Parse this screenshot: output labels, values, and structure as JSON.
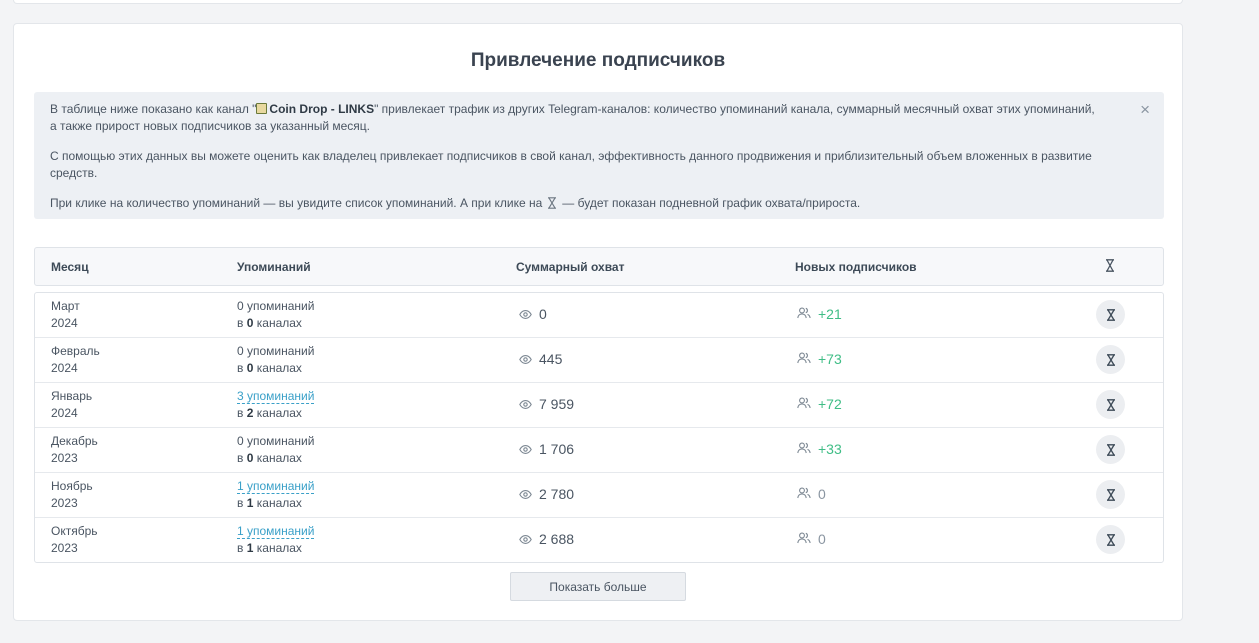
{
  "title": "Привлечение подписчиков",
  "info": {
    "p1_before": "В таблице ниже показано как канал \"",
    "channel_name": "Coin Drop - LINKS",
    "p1_after": "\" привлекает трафик из других Telegram-каналов: количество упоминаний канала, суммарный месячный охват этих упоминаний, а также прирост новых подписчиков за указанный месяц.",
    "p2": "С помощью этих данных вы можете оценить как владелец привлекает подписчиков в свой канал, эффективность данного продвижения и приблизительный объем вложенных в развитие средств.",
    "p3_before": "При клике на количество упоминаний — вы увидите список упоминаний. А при клике на",
    "p3_after": "— будет показан подневной график охвата/прироста.",
    "close": "×"
  },
  "table": {
    "headers": {
      "month": "Месяц",
      "mentions": "Упоминаний",
      "reach": "Суммарный охват",
      "subs": "Новых подписчиков"
    },
    "rows": [
      {
        "month": "Март",
        "year": "2024",
        "mentions": "0 упоминаний",
        "mentions_link": false,
        "ch_prefix": "в",
        "channels": "0",
        "ch_suffix": "каналах",
        "reach": "0",
        "subs": "+21",
        "subs_positive": true
      },
      {
        "month": "Февраль",
        "year": "2024",
        "mentions": "0 упоминаний",
        "mentions_link": false,
        "ch_prefix": "в",
        "channels": "0",
        "ch_suffix": "каналах",
        "reach": "445",
        "subs": "+73",
        "subs_positive": true
      },
      {
        "month": "Январь",
        "year": "2024",
        "mentions": "3 упоминаний",
        "mentions_link": true,
        "ch_prefix": "в",
        "channels": "2",
        "ch_suffix": "каналах",
        "reach": "7 959",
        "subs": "+72",
        "subs_positive": true
      },
      {
        "month": "Декабрь",
        "year": "2023",
        "mentions": "0 упоминаний",
        "mentions_link": false,
        "ch_prefix": "в",
        "channels": "0",
        "ch_suffix": "каналах",
        "reach": "1 706",
        "subs": "+33",
        "subs_positive": true
      },
      {
        "month": "Ноябрь",
        "year": "2023",
        "mentions": "1 упоминаний",
        "mentions_link": true,
        "ch_prefix": "в",
        "channels": "1",
        "ch_suffix": "каналах",
        "reach": "2 780",
        "subs": "0",
        "subs_positive": false
      },
      {
        "month": "Октябрь",
        "year": "2023",
        "mentions": "1 упоминаний",
        "mentions_link": true,
        "ch_prefix": "в",
        "channels": "1",
        "ch_suffix": "каналах",
        "reach": "2 688",
        "subs": "0",
        "subs_positive": false
      }
    ]
  },
  "more_label": "Показать больше",
  "icons": {
    "hourglass": "hourglass-icon",
    "eye": "eye-icon",
    "users": "users-icon",
    "close": "close-icon",
    "channel": "channel-emoji-icon"
  },
  "colors": {
    "positive": "#3fbd86",
    "link": "#3aa0c8",
    "info_bg": "#edf0f4"
  }
}
